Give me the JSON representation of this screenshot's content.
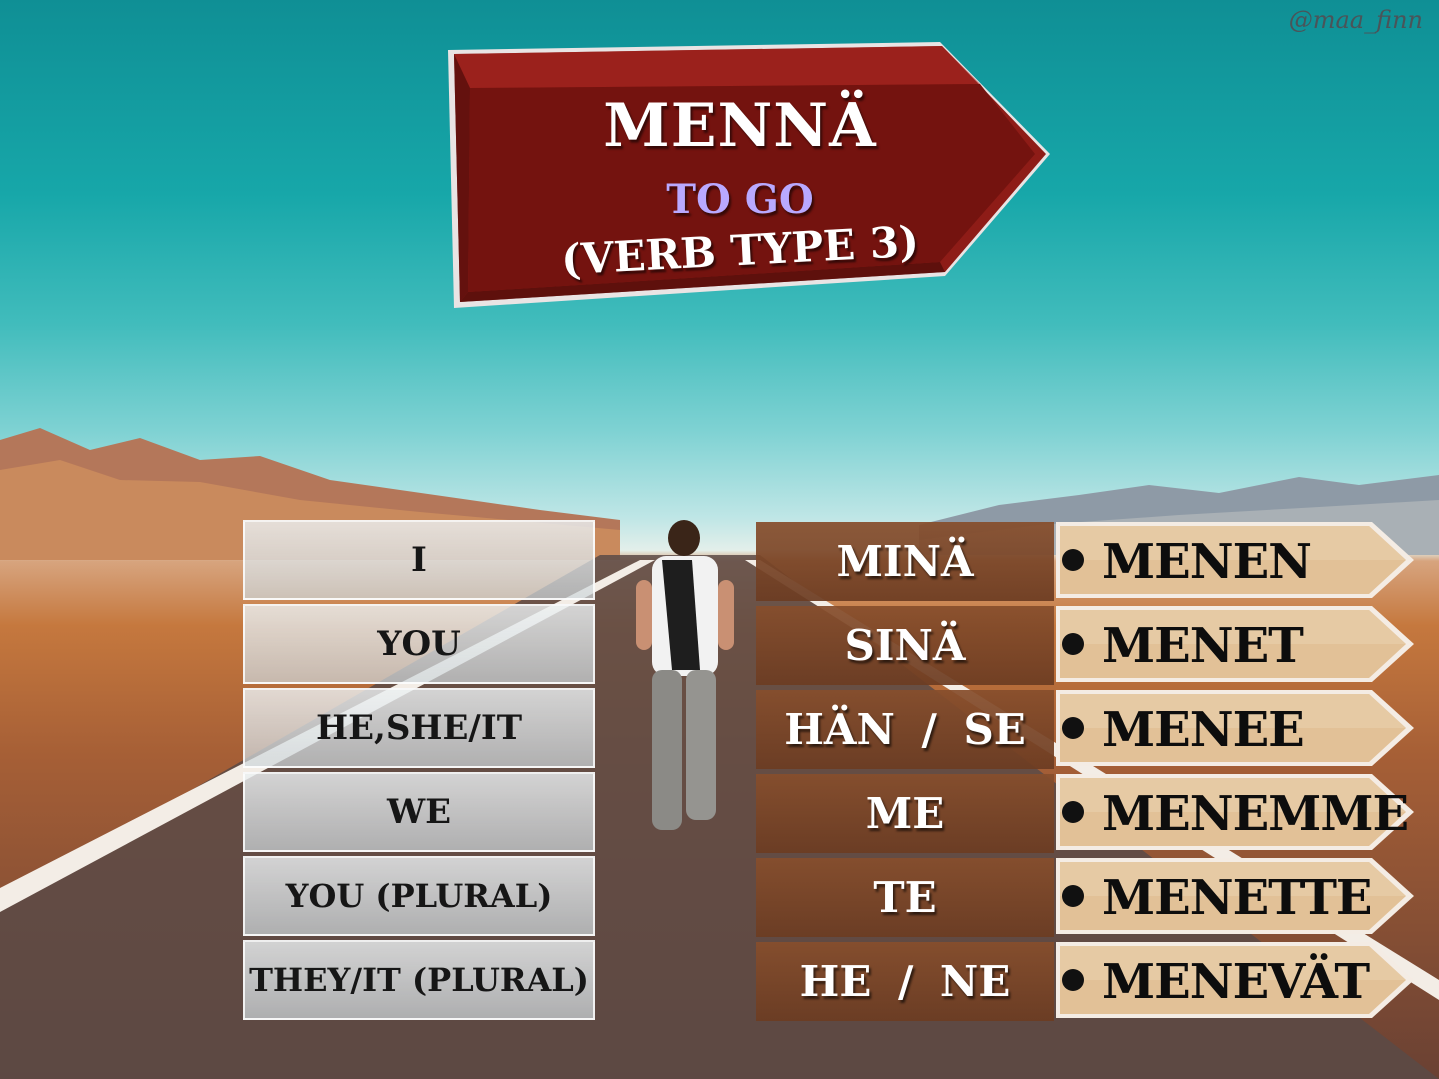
{
  "watermark": "@maa_finn",
  "sign": {
    "title": "MENNÄ",
    "translation": "TO GO",
    "verb_type": "(VERB TYPE 3)"
  },
  "colors": {
    "sign_red": "#7a1613",
    "translation_purple": "#b9a9ff",
    "pronoun_brown": "#874e2c",
    "arrow_tan": "#e2c197"
  },
  "rows": [
    {
      "english": "I",
      "finnish": "MINÄ",
      "form": "MENEN"
    },
    {
      "english": "YOU",
      "finnish": "SINÄ",
      "form": "MENET"
    },
    {
      "english": "HE,SHE/IT",
      "finnish": "HÄN / SE",
      "form": "MENEE"
    },
    {
      "english": "WE",
      "finnish": "ME",
      "form": "MENEMME"
    },
    {
      "english": "YOU (PLURAL)",
      "finnish": "TE",
      "form": "MENETTE"
    },
    {
      "english": "THEY/IT (PLURAL)",
      "finnish": "HE / NE",
      "form": "MENEVÄT"
    }
  ]
}
